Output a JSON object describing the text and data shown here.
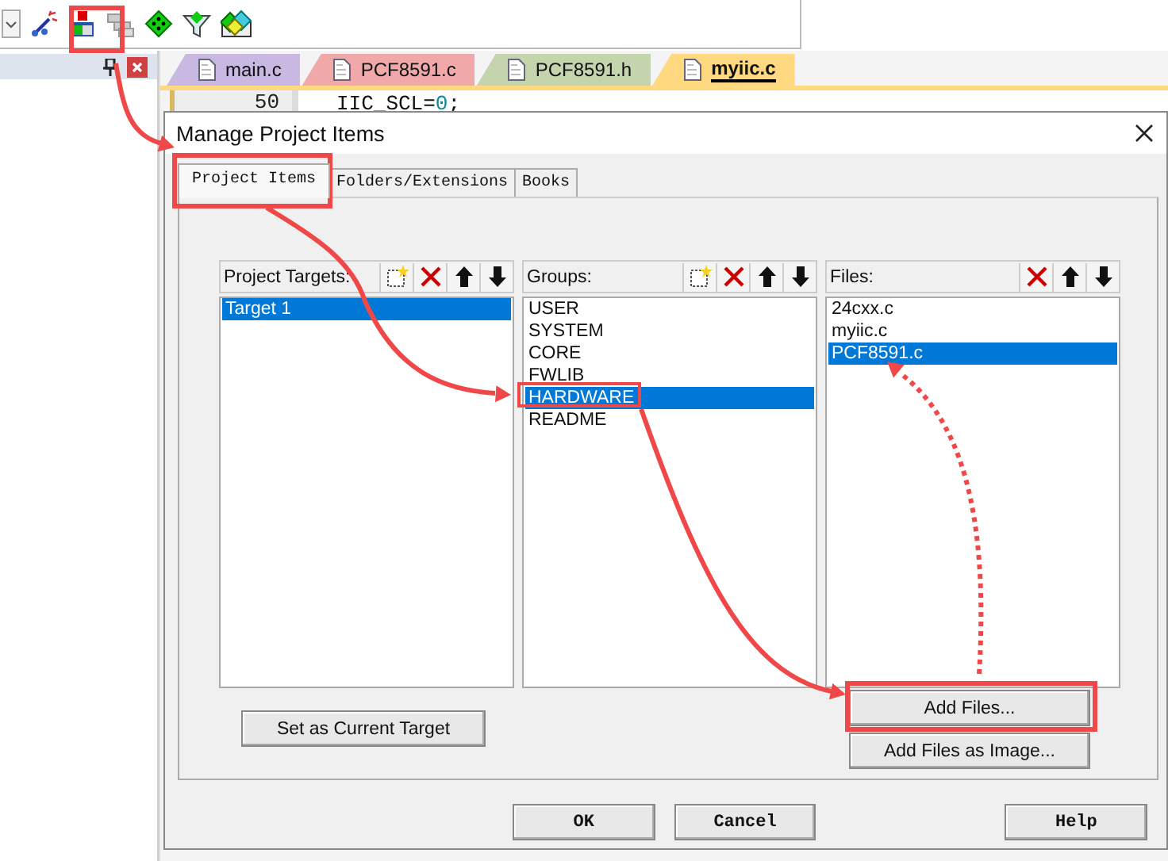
{
  "editor": {
    "tabs": [
      {
        "label": "main.c",
        "color": "#c8b8e2",
        "selected": false
      },
      {
        "label": "PCF8591.c",
        "color": "#f0a8a8",
        "selected": false
      },
      {
        "label": "PCF8591.h",
        "color": "#c4d4ac",
        "selected": false
      },
      {
        "label": "myiic.c",
        "color": "#ffd880",
        "selected": true
      }
    ],
    "code_line": {
      "line_number": "50",
      "parts": [
        {
          "kind": "plain",
          "text": "IIC_SCL="
        },
        {
          "kind": "number",
          "text": "0"
        },
        {
          "kind": "plain",
          "text": ";"
        }
      ]
    }
  },
  "dialog": {
    "title": "Manage Project Items",
    "tabs": [
      {
        "label": "Project Items",
        "selected": true
      },
      {
        "label": "Folders/Extensions",
        "selected": false
      },
      {
        "label": "Books",
        "selected": false
      }
    ],
    "panels": [
      {
        "header": "Project Targets:",
        "kind": "targets",
        "items": [
          {
            "label": "Target 1",
            "selected": true
          }
        ]
      },
      {
        "header": "Groups:",
        "kind": "groups",
        "items": [
          {
            "label": "USER",
            "selected": false
          },
          {
            "label": "SYSTEM",
            "selected": false
          },
          {
            "label": "CORE",
            "selected": false
          },
          {
            "label": "FWLIB",
            "selected": false
          },
          {
            "label": "HARDWARE",
            "selected": true
          },
          {
            "label": "README",
            "selected": false
          }
        ]
      },
      {
        "header": "Files:",
        "kind": "files",
        "items": [
          {
            "label": "24cxx.c",
            "selected": false
          },
          {
            "label": "myiic.c",
            "selected": false
          },
          {
            "label": "PCF8591.c",
            "selected": true
          }
        ]
      }
    ],
    "target_button": "Set as Current Target",
    "file_buttons": [
      "Add Files...",
      "Add Files as Image..."
    ],
    "buttons": [
      "OK",
      "Cancel",
      "Help"
    ]
  }
}
